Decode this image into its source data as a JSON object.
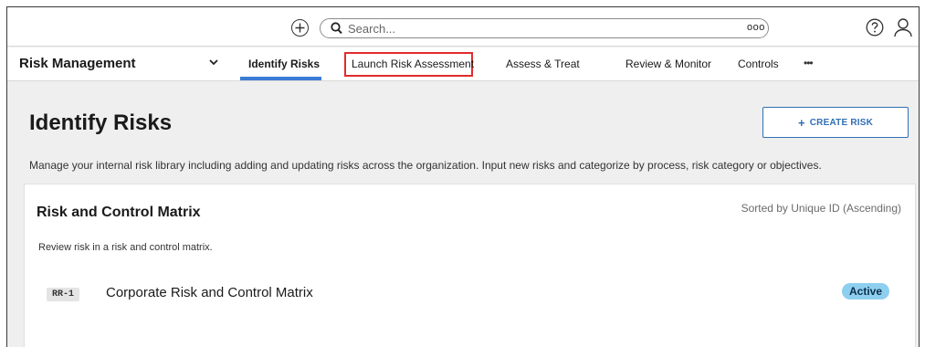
{
  "topbar": {
    "search_placeholder": "Search...",
    "search_suffix": "ooo"
  },
  "nav": {
    "module": "Risk Management",
    "tabs": [
      {
        "label": "Identify Risks",
        "active": true
      },
      {
        "label": "Launch Risk Assessment",
        "highlighted": true
      },
      {
        "label": "Assess & Treat"
      },
      {
        "label": "Review & Monitor"
      },
      {
        "label": "Controls"
      }
    ],
    "more": "•••"
  },
  "page": {
    "title": "Identify Risks",
    "create_button": "CREATE RISK",
    "description": "Manage your internal risk library including adding and updating risks across the organization. Input new risks and categorize by process, risk category or objectives."
  },
  "card": {
    "title": "Risk and Control Matrix",
    "sorted_label": "Sorted by Unique ID (Ascending)",
    "description": "Review risk in a risk and control matrix.",
    "rows": [
      {
        "id": "RR-1",
        "name": "Corporate Risk and Control Matrix",
        "status": "Active"
      }
    ]
  },
  "colors": {
    "accent": "#3a7bd5",
    "highlight": "#e22b2b",
    "status_active": "#8ecff0"
  }
}
